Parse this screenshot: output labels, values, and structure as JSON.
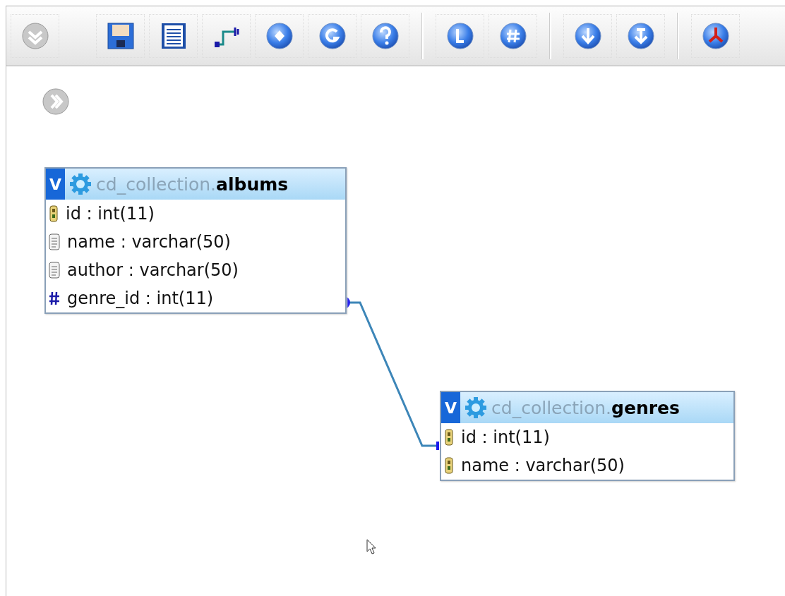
{
  "tables": [
    {
      "toggle": "V",
      "database": "cd_collection.",
      "name": "albums",
      "columns": [
        {
          "kind": "key",
          "label": "id : int(11)"
        },
        {
          "kind": "text",
          "label": "name : varchar(50)"
        },
        {
          "kind": "text",
          "label": "author : varchar(50)"
        },
        {
          "kind": "number",
          "label": "genre_id : int(11)"
        }
      ]
    },
    {
      "toggle": "V",
      "database": "cd_collection.",
      "name": "genres",
      "columns": [
        {
          "kind": "key",
          "label": "id : int(11)"
        },
        {
          "kind": "key",
          "label": "name : varchar(50)"
        }
      ]
    }
  ]
}
